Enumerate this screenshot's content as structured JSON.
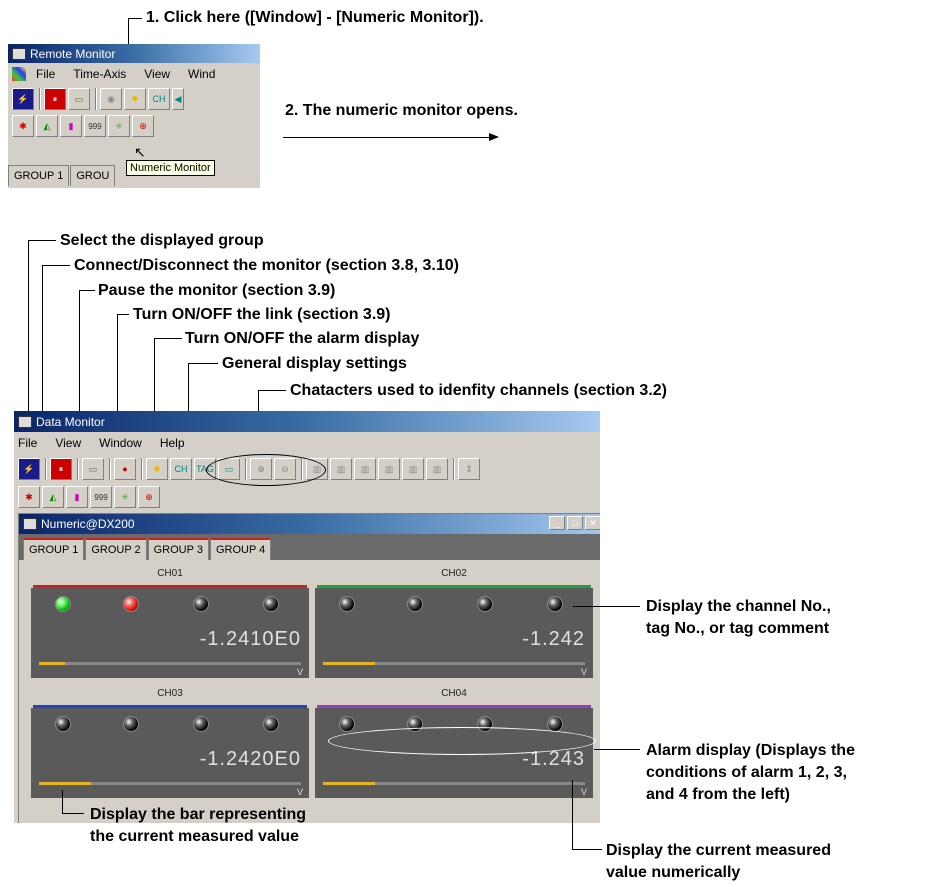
{
  "annotations": {
    "step1": "1. Click here ([Window] - [Numeric Monitor]).",
    "step2": "2. The numeric monitor opens.",
    "select_group": "Select the displayed group",
    "connect": "Connect/Disconnect the monitor (section 3.8, 3.10)",
    "pause": "Pause the monitor (section 3.9)",
    "link": "Turn ON/OFF the link (section 3.9)",
    "alarm_toggle": "Turn ON/OFF the alarm display",
    "general": "General display settings",
    "chars": "Chatacters used to idenfity channels (section 3.2)",
    "channel_no_1": "Display the channel No.,",
    "channel_no_2": "tag No., or tag comment",
    "alarm_disp_1": "Alarm display (Displays the",
    "alarm_disp_2": "conditions of alarm 1, 2, 3,",
    "alarm_disp_3": "and 4 from the left)",
    "bar_1": "Display the bar representing",
    "bar_2": "the current measured value",
    "numeric_1": "Display the current measured",
    "numeric_2": "value numerically"
  },
  "remote_monitor": {
    "title": "Remote Monitor",
    "menu": [
      "File",
      "Time-Axis",
      "View",
      "Wind"
    ],
    "tabs": [
      "GROUP 1",
      "GROU"
    ],
    "tooltip": "Numeric Monitor"
  },
  "data_monitor": {
    "title": "Data Monitor",
    "menu": [
      "File",
      "View",
      "Window",
      "Help"
    ],
    "child_title": "Numeric@DX200",
    "tabs": [
      "GROUP 1",
      "GROUP 2",
      "GROUP 3",
      "GROUP 4"
    ],
    "channels": [
      {
        "name": "CH01",
        "value": "-1.2410E0",
        "unit": "V",
        "color": "#d02020",
        "lamps": [
          "green",
          "red",
          "off",
          "off"
        ],
        "bar": 0.1
      },
      {
        "name": "CH02",
        "value": "-1.242",
        "unit": "V",
        "color": "#20a040",
        "lamps": [
          "off",
          "off",
          "off",
          "off"
        ],
        "bar": 0.2
      },
      {
        "name": "CH03",
        "value": "-1.2420E0",
        "unit": "V",
        "color": "#2040d0",
        "lamps": [
          "off",
          "off",
          "off",
          "off"
        ],
        "bar": 0.2
      },
      {
        "name": "CH04",
        "value": "-1.243",
        "unit": "V",
        "color": "#9040c0",
        "lamps": [
          "off",
          "off",
          "off",
          "off"
        ],
        "bar": 0.2
      }
    ]
  }
}
